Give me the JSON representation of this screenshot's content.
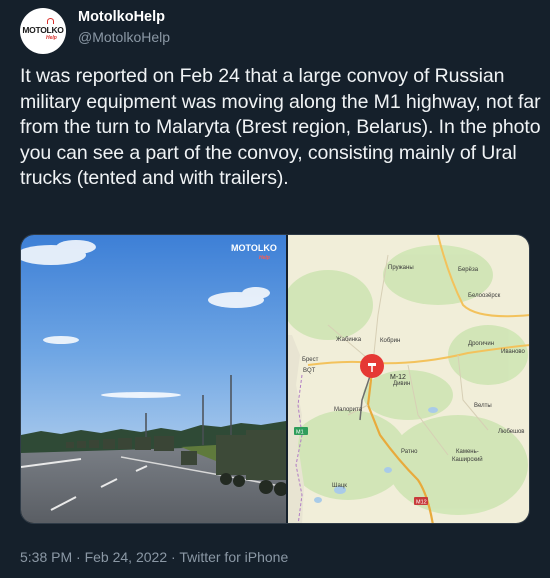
{
  "tweet": {
    "display_name": "MotolkoHelp",
    "handle": "@MotolkoHelp",
    "avatar_text": "MOTOLKO",
    "avatar_sub": "Help",
    "text": "It was reported on Feb 24 that a large convoy of Russian military equipment  was moving along the M1 highway, not far from the turn to Malaryta (Brest region, Belarus). In the photo you can see a part of the convoy, consisting mainly of Ural trucks (tented and with trailers).",
    "time": "5:38 PM",
    "sep": "·",
    "date": "Feb 24, 2022",
    "source": "Twitter for iPhone"
  },
  "photo": {
    "watermark": "MOTOLKO",
    "watermark_sub": "Help"
  },
  "map": {
    "labels": {
      "pruzhany": "Пружаны",
      "bereza": "Берёза",
      "beloozersk": "Белоозёрск",
      "zhabinka": "Жабинка",
      "kobrin": "Кобрин",
      "drogichin": "Дрогичин",
      "ivanovo": "Иваново",
      "brest": "Брест",
      "bqt": "BQT",
      "m12": "M-12",
      "divin": "Дивин",
      "malorita": "Малорита",
      "velty": "Велты",
      "lyubeshov": "Любешов",
      "ratno": "Ратно",
      "kamen": "Камень-",
      "kashirsky": "Каширский",
      "shatsk": "Шацк",
      "road_m1": "M1",
      "road_m12": "M12"
    }
  },
  "colors": {
    "background": "#15202b",
    "secondary_text": "#8b98a5",
    "pin": "#e53935"
  }
}
